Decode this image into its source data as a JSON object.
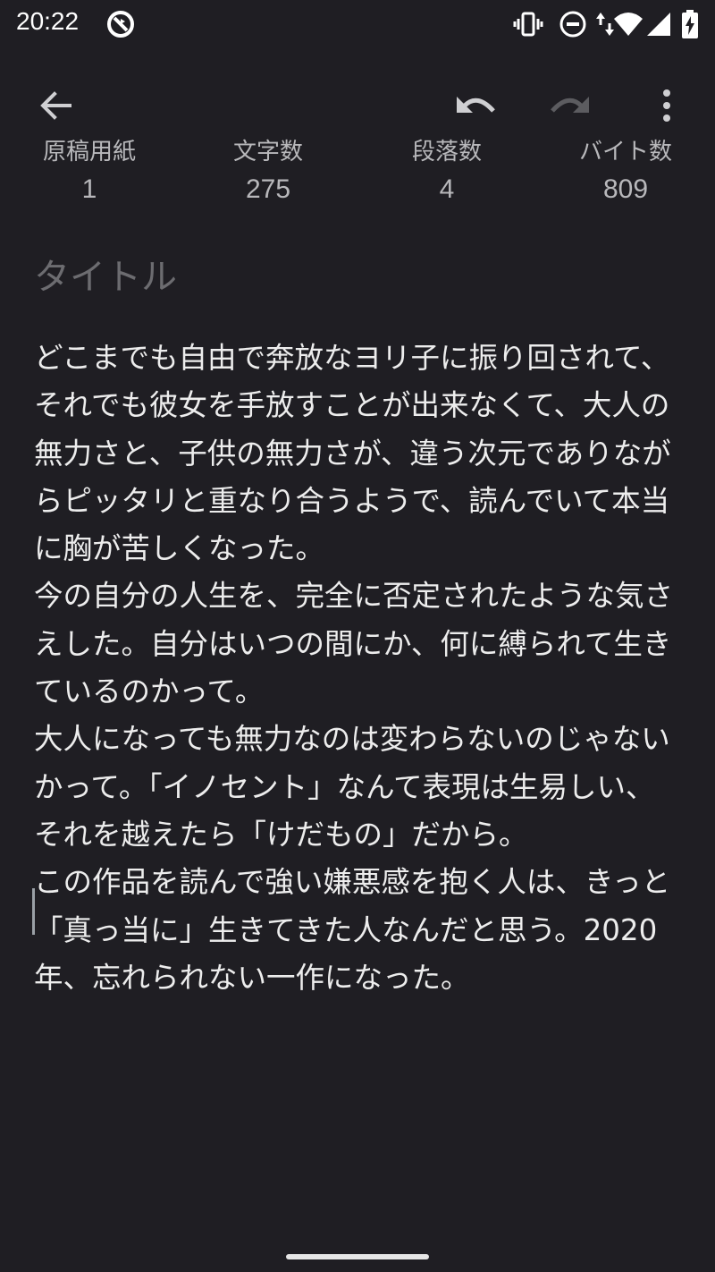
{
  "status_bar": {
    "time": "20:22",
    "icons": [
      "no-sync-icon",
      "vibrate-icon",
      "do-not-disturb-icon",
      "wifi-icon",
      "signal-icon",
      "battery-charging-icon"
    ]
  },
  "toolbar": {
    "back_icon": "arrow-left-icon",
    "undo_icon": "undo-icon",
    "redo_icon": "redo-icon",
    "menu_icon": "more-vert-icon"
  },
  "stats": [
    {
      "label": "原稿用紙",
      "value": "1"
    },
    {
      "label": "文字数",
      "value": "275"
    },
    {
      "label": "段落数",
      "value": "4"
    },
    {
      "label": "バイト数",
      "value": "809"
    }
  ],
  "editor": {
    "title_placeholder": "タイトル",
    "body": "どこまでも自由で奔放なヨリ子に振り回されて、それでも彼女を手放すことが出来なくて、大人の無力さと、子供の無力さが、違う次元でありながらピッタリと重なり合うようで、読んでいて本当に胸が苦しくなった。\n今の自分の人生を、完全に否定されたような気さえした。自分はいつの間にか、何に縛られて生きているのかって。\n大人になっても無力なのは変わらないのじゃないかって。「イノセント」なんて表現は生易しい、それを越えたら「けだもの」だから。\nこの作品を読んで強い嫌悪感を抱く人は、きっと「真っ当に」生きてきた人なんだと思う。2020 年、忘れられない一作になった。"
  },
  "colors": {
    "background": "#1f1e23",
    "text": "#ededed",
    "muted": "#b8b8bb",
    "placeholder": "#6c6c70"
  }
}
